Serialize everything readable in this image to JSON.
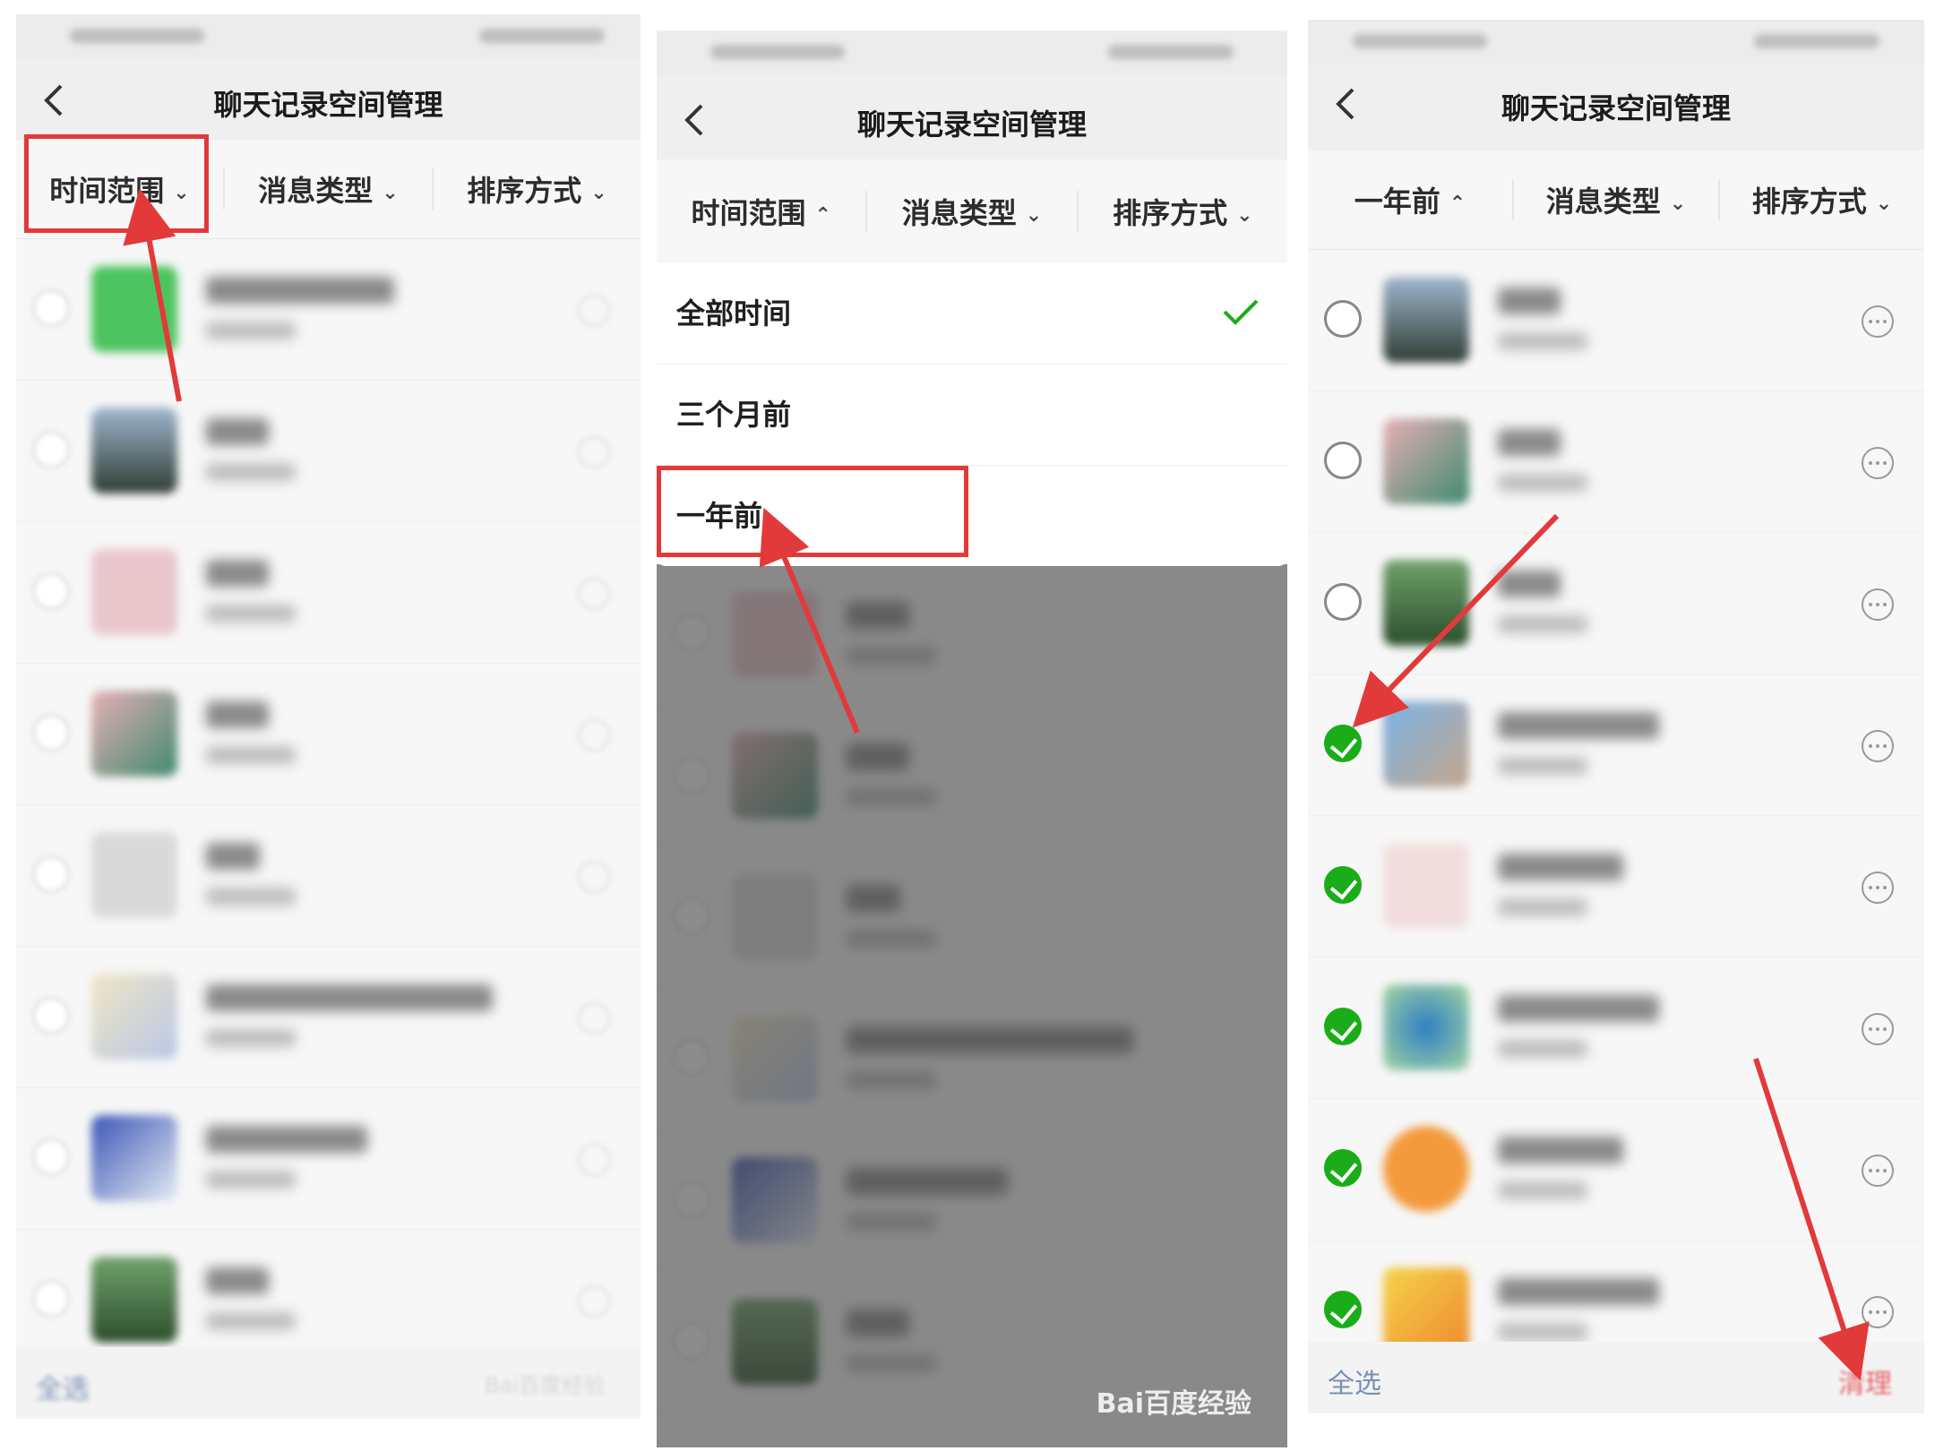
{
  "title": "聊天记录空间管理",
  "filters": {
    "time_range": "时间范围",
    "message_type": "消息类型",
    "sort": "排序方式",
    "one_year_ago": "一年前"
  },
  "dropdown": {
    "options": [
      "全部时间",
      "三个月前",
      "一年前"
    ],
    "selected": "全部时间"
  },
  "bottom": {
    "select_all": "全选",
    "clean": "清理"
  },
  "watermark": "Bai百度经验",
  "colors": {
    "highlight": "#e23a3a",
    "check_green": "#1aad19",
    "link_blue": "#7a8fb5"
  },
  "icons": {
    "back": "chevron-left-icon",
    "dropdown_chevron": "chevron-down-icon",
    "dropdown_chevron_open": "chevron-up-icon",
    "more": "more-horizontal-icon",
    "check": "checkmark-icon"
  }
}
